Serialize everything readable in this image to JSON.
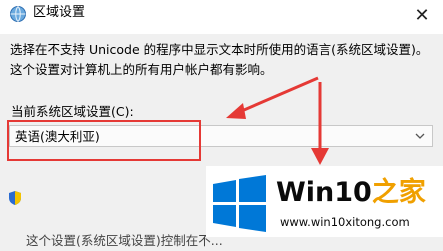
{
  "window": {
    "title": "区域设置",
    "close_glyph": "✕"
  },
  "content": {
    "description": "选择在不支持 Unicode 的程序中显示文本时所使用的语言(系统区域设置)。这个设置对计算机上的所有用户帐户都有影响。",
    "current_locale_label": "当前系统区域设置(C):",
    "current_locale_value": "英语(澳大利亚)",
    "bottom_text": "这个设置(系统区域设置)控制在不..."
  },
  "watermark": {
    "brand_a": "Win10",
    "brand_b": "之家",
    "url": "www.win10xitong.com"
  },
  "colors": {
    "highlight": "#e53935",
    "windows_blue": "#0078d7",
    "brand_orange": "#f0a000"
  },
  "icons": {
    "title": "globe-icon",
    "dropdown": "chevron-down-icon",
    "shield": "shield-icon",
    "close": "close-icon"
  }
}
